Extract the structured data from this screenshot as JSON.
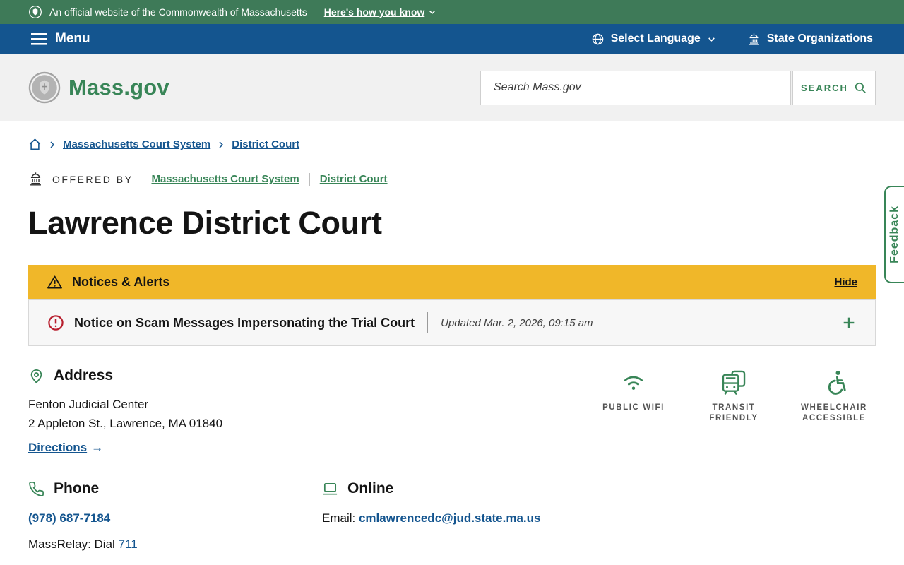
{
  "banner": {
    "official_text": "An official website of the Commonwealth of Massachusetts",
    "how_you_know": "Here's how you know"
  },
  "navbar": {
    "menu_label": "Menu",
    "select_language": "Select Language",
    "state_organizations": "State Organizations"
  },
  "header": {
    "logo_text": "Mass.gov",
    "search_placeholder": "Search Mass.gov",
    "search_button": "SEARCH"
  },
  "breadcrumb": {
    "links": [
      "Massachusetts Court System",
      "District Court"
    ]
  },
  "offered_by": {
    "label": "OFFERED BY",
    "links": [
      "Massachusetts Court System",
      "District Court"
    ]
  },
  "page": {
    "title": "Lawrence District Court"
  },
  "alerts": {
    "header": "Notices & Alerts",
    "hide_label": "Hide",
    "notice_title": "Notice on Scam Messages Impersonating the Trial Court",
    "notice_updated": "Updated Mar. 2, 2026, 09:15 am"
  },
  "address": {
    "heading": "Address",
    "line1": "Fenton Judicial Center",
    "line2": "2 Appleton St., Lawrence, MA 01840",
    "directions_label": "Directions",
    "arrow_glyph": "→"
  },
  "amenities": {
    "items": [
      {
        "icon": "wifi-icon",
        "label": "PUBLIC WIFI"
      },
      {
        "icon": "transit-icon",
        "label": "TRANSIT FRIENDLY"
      },
      {
        "icon": "wheelchair-icon",
        "label": "WHEELCHAIR ACCESSIBLE"
      }
    ]
  },
  "phone": {
    "heading": "Phone",
    "number": "(978) 687-7184",
    "massrelay_prefix": "MassRelay: Dial ",
    "massrelay_number": "711"
  },
  "online": {
    "heading": "Online",
    "email_prefix": "Email: ",
    "email": "cmlawrencedc@jud.state.ma.us"
  },
  "feedback": {
    "label": "Feedback"
  },
  "colors": {
    "banner_green": "#3e7a58",
    "brand_green": "#388557",
    "nav_blue": "#14558f",
    "alert_yellow": "#f0b729",
    "alert_red": "#b81f2e"
  }
}
